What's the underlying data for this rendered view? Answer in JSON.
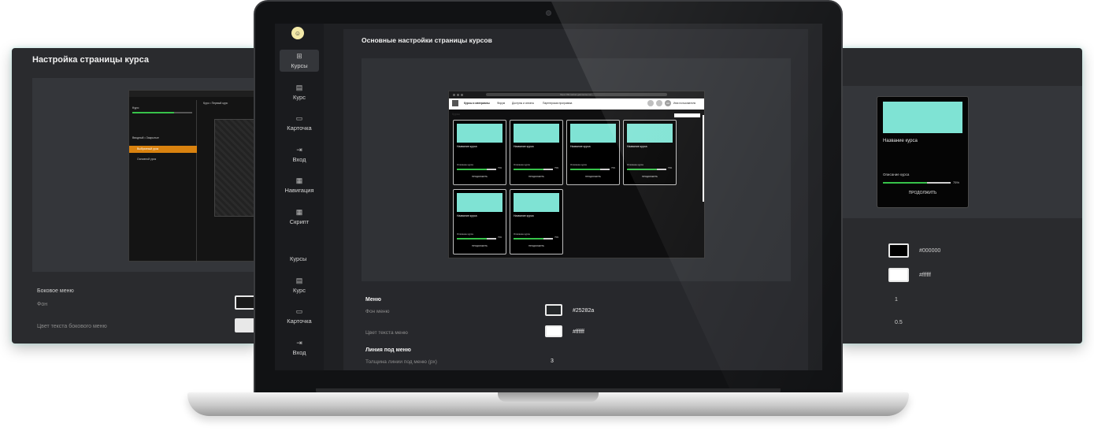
{
  "left_panel": {
    "title": "Настройка страницы курса",
    "section": "Боковое меню",
    "field_bg": "Фон",
    "field_text_color": "Цвет текста бокового меню",
    "preview": {
      "tab_label": "Курс • Первый курс",
      "course_label": "Курс",
      "lesson_items": [
        "Вводный • Закрытые",
        "Выбранный урок",
        "Основной урок"
      ]
    }
  },
  "right_panel": {
    "card_name": "Название курса",
    "card_desc": "Описание курса",
    "card_pct": "75%",
    "card_button": "ПРОДОЛЖИТЬ",
    "values": [
      "#000000",
      "#ffffff",
      "1",
      "0.5"
    ],
    "progress": 0.65
  },
  "sidebar": {
    "items": [
      {
        "label": "Курсы",
        "icon": "grid-icon",
        "active": true
      },
      {
        "label": "Курс",
        "icon": "list-icon"
      },
      {
        "label": "Карточка",
        "icon": "card-icon"
      },
      {
        "label": "Вход",
        "icon": "login-icon"
      },
      {
        "label": "Навигация",
        "icon": "nav-icon"
      },
      {
        "label": "Скрипт",
        "icon": "script-icon"
      }
    ],
    "items_repeat": [
      {
        "label": "Курсы"
      },
      {
        "label": "Курс",
        "icon": "list-icon"
      },
      {
        "label": "Карточка",
        "icon": "card-icon"
      },
      {
        "label": "Вход",
        "icon": "login-icon"
      }
    ]
  },
  "main": {
    "title": "Основные настройки страницы курсов",
    "preview": {
      "url": "https://fibmarket.getcourse.ru/...",
      "nav_items": [
        "Курсы и материалы",
        "Форум",
        "Доступы и оплаты",
        "Партнерская программа"
      ],
      "user_name": "Имя пользователя",
      "user_initials": "АА",
      "list_title": "Курсы",
      "cards": [
        {
          "name": "Название курса",
          "desc": "Описание курса",
          "pct": "75%",
          "button": "ПРОДОЛЖИТЬ",
          "progress": 0.75
        },
        {
          "name": "Название курса",
          "desc": "Описание курса",
          "pct": "75%",
          "button": "ПРОДОЛЖИТЬ",
          "progress": 0.75
        },
        {
          "name": "Название курса",
          "desc": "Описание курса",
          "pct": "75%",
          "button": "ПРОДОЛЖИТЬ",
          "progress": 0.75
        },
        {
          "name": "Название курса",
          "desc": "Описание курса",
          "pct": "75%",
          "button": "ПРОДОЛЖИТЬ",
          "progress": 0.75
        },
        {
          "name": "Название курса",
          "desc": "Описание курса",
          "pct": "75%",
          "button": "ПРОДОЛЖИТЬ",
          "progress": 0.75
        },
        {
          "name": "Название курса",
          "desc": "Описание курса",
          "pct": "75%",
          "button": "ПРОДОЛЖИТЬ",
          "progress": 0.75
        }
      ]
    },
    "menu_section": "Меню",
    "menu_bg_label": "Фон меню",
    "menu_bg_value": "#25282a",
    "menu_text_label": "Цвет текста меню",
    "menu_text_value": "#ffffff",
    "line_section": "Линия под меню",
    "line_thickness_label": "Толщина линии под меню (px)",
    "line_thickness_value": "3"
  },
  "colors": {
    "accent": "#7fe3d4",
    "progress": "#37c24a",
    "active_orange": "#d9820f"
  }
}
